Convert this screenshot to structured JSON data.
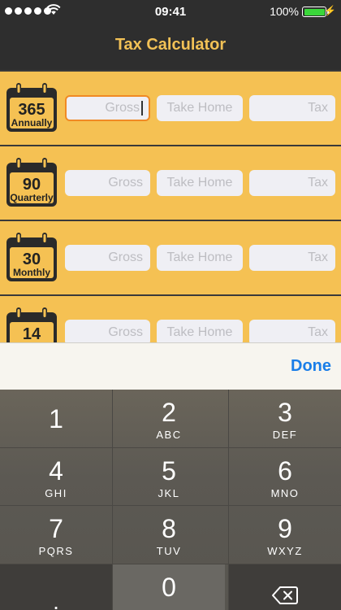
{
  "status": {
    "time": "09:41",
    "battery": "100%"
  },
  "nav": {
    "title": "Tax Calculator"
  },
  "rows": [
    {
      "day_count": "365",
      "period": "Annually",
      "gross": "Gross",
      "take_home": "Take Home",
      "tax": "Tax"
    },
    {
      "day_count": "90",
      "period": "Quarterly",
      "gross": "Gross",
      "take_home": "Take Home",
      "tax": "Tax"
    },
    {
      "day_count": "30",
      "period": "Monthly",
      "gross": "Gross",
      "take_home": "Take Home",
      "tax": "Tax"
    },
    {
      "day_count": "14",
      "period": "",
      "gross": "Gross",
      "take_home": "Take Home",
      "tax": "Tax"
    }
  ],
  "accessory": {
    "done_label": "Done"
  },
  "keypad": {
    "keys": [
      {
        "num": "1",
        "letters": ""
      },
      {
        "num": "2",
        "letters": "ABC"
      },
      {
        "num": "3",
        "letters": "DEF"
      },
      {
        "num": "4",
        "letters": "GHI"
      },
      {
        "num": "5",
        "letters": "JKL"
      },
      {
        "num": "6",
        "letters": "MNO"
      },
      {
        "num": "7",
        "letters": "PQRS"
      },
      {
        "num": "8",
        "letters": "TUV"
      },
      {
        "num": "9",
        "letters": "WXYZ"
      },
      {
        "num": "0",
        "letters": ""
      }
    ],
    "decimal": "."
  },
  "colors": {
    "accent": "#f5c153",
    "title": "#f2c156",
    "done": "#1a7ee8",
    "focus": "#f08a24"
  }
}
